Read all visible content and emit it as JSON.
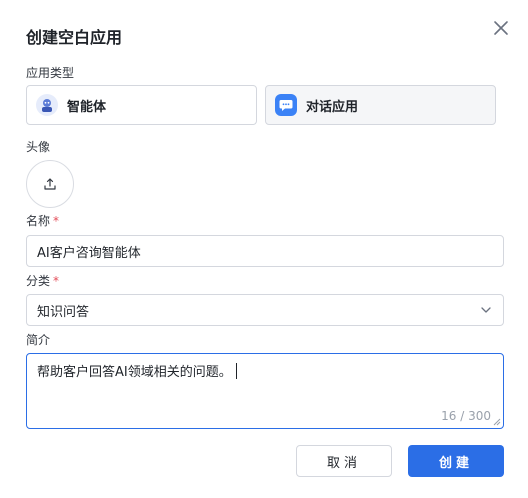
{
  "dialog": {
    "title": "创建空白应用"
  },
  "app_type": {
    "label": "应用类型",
    "options": [
      {
        "label": "智能体",
        "icon": "robot-avatar-icon"
      },
      {
        "label": "对话应用",
        "icon": "chat-bubble-icon"
      }
    ]
  },
  "avatar": {
    "label": "头像",
    "icon": "upload-icon"
  },
  "name": {
    "label": "名称",
    "required_mark": "*",
    "value": "AI客户咨询智能体"
  },
  "category": {
    "label": "分类",
    "required_mark": "*",
    "value": "知识问答"
  },
  "intro": {
    "label": "简介",
    "value": "帮助客户回答AI领域相关的问题。",
    "counter": "16 / 300"
  },
  "footer": {
    "cancel_label": "取消",
    "create_label": "创建"
  },
  "colors": {
    "primary": "#2b6ee6",
    "required": "#e34d59"
  }
}
